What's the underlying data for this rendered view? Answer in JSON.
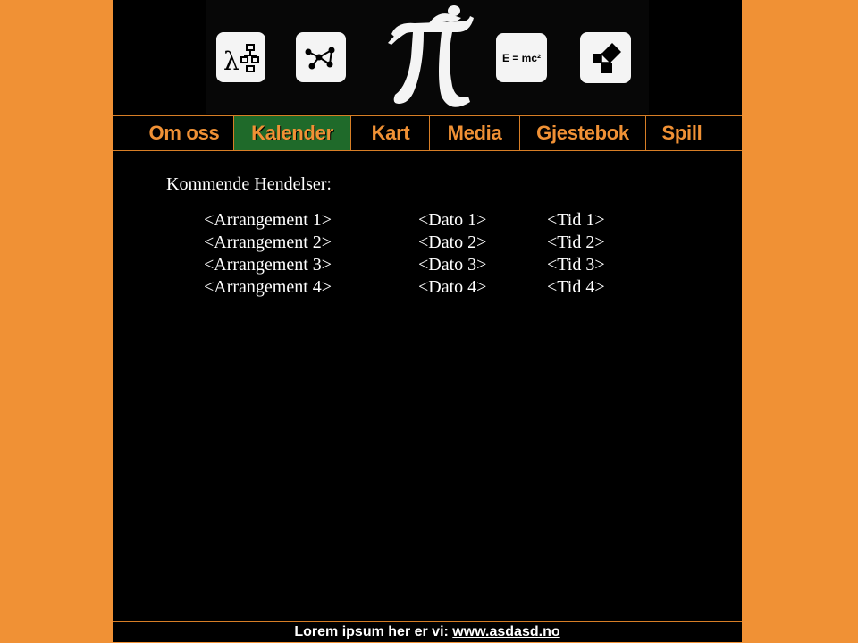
{
  "banner": {
    "icons": [
      "lambda-flowchart-icon",
      "graph-network-icon",
      "pi-figure-icon",
      "emc2-icon",
      "pythagoras-icon"
    ],
    "emc2_text": "E = mc²",
    "lambda_text": "λ"
  },
  "nav": {
    "items": [
      {
        "label": "Om oss"
      },
      {
        "label": "Kalender"
      },
      {
        "label": "Kart"
      },
      {
        "label": "Media"
      },
      {
        "label": "Gjestebok"
      },
      {
        "label": "Spill"
      }
    ],
    "active": "Kalender"
  },
  "main": {
    "heading": "Kommende Hendelser:",
    "events": [
      {
        "name": "<Arrangement 1>",
        "date": "<Dato 1>",
        "time": "<Tid 1>"
      },
      {
        "name": "<Arrangement 2>",
        "date": "<Dato 2>",
        "time": "<Tid 2>"
      },
      {
        "name": "<Arrangement 3>",
        "date": "<Dato 3>",
        "time": "<Tid 3>"
      },
      {
        "name": "<Arrangement 4>",
        "date": "<Dato 4>",
        "time": "<Tid 4>"
      }
    ]
  },
  "footer": {
    "text": "Lorem ipsum her er vi: ",
    "link": "www.asdasd.no"
  },
  "colors": {
    "background": "#f09135",
    "page": "#000000",
    "accent": "#f09135",
    "active_nav": "#1f6a2a"
  }
}
